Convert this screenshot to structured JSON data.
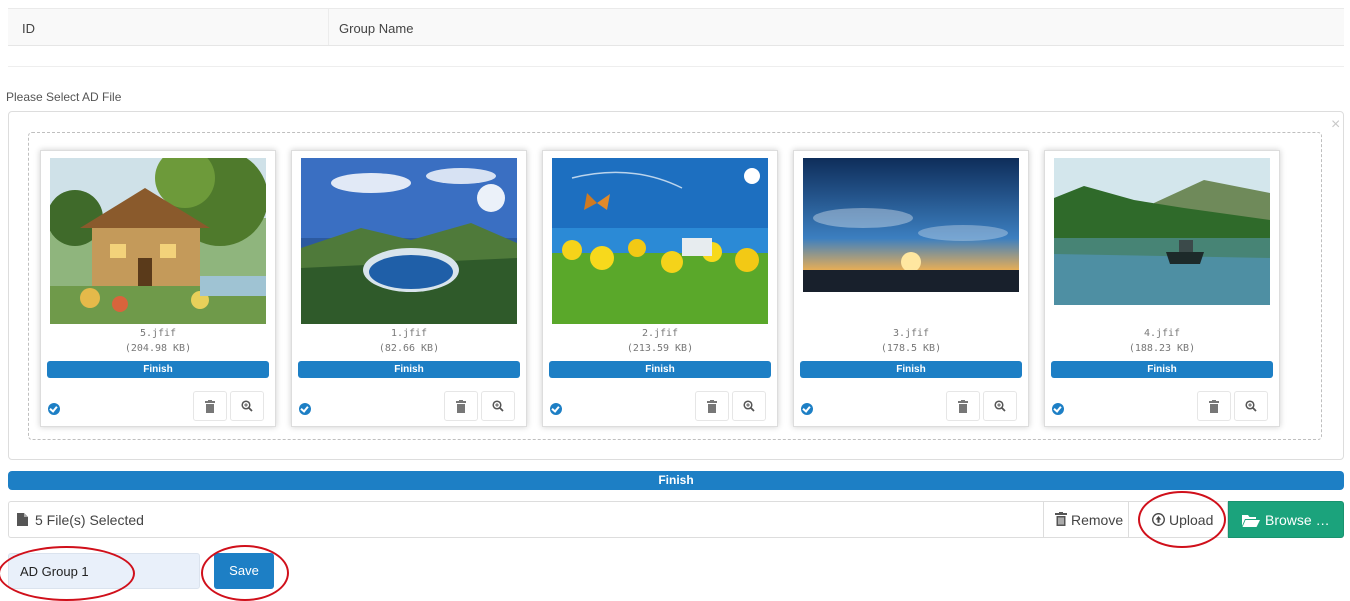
{
  "table": {
    "columns": [
      "ID",
      "Group Name"
    ]
  },
  "upload": {
    "prompt": "Please Select AD File",
    "close_symbol": "×",
    "files": [
      {
        "name": "5.jfif",
        "size": "(204.98 KB)",
        "status": "Finish"
      },
      {
        "name": "1.jfif",
        "size": "(82.66 KB)",
        "status": "Finish"
      },
      {
        "name": "2.jfif",
        "size": "(213.59 KB)",
        "status": "Finish"
      },
      {
        "name": "3.jfif",
        "size": "(178.5 KB)",
        "status": "Finish"
      },
      {
        "name": "4.jfif",
        "size": "(188.23 KB)",
        "status": "Finish"
      }
    ],
    "overall_status": "Finish",
    "overall_progress": 1.0,
    "caption": "5  File(s) Selected",
    "remove_label": "Remove",
    "upload_label": "Upload",
    "browse_label": "Browse …"
  },
  "form": {
    "group_name_value": "AD Group 1",
    "save_label": "Save"
  },
  "colors": {
    "primary": "#1d7fc5",
    "browse": "#1ba37c",
    "annotation": "#d0101b"
  }
}
